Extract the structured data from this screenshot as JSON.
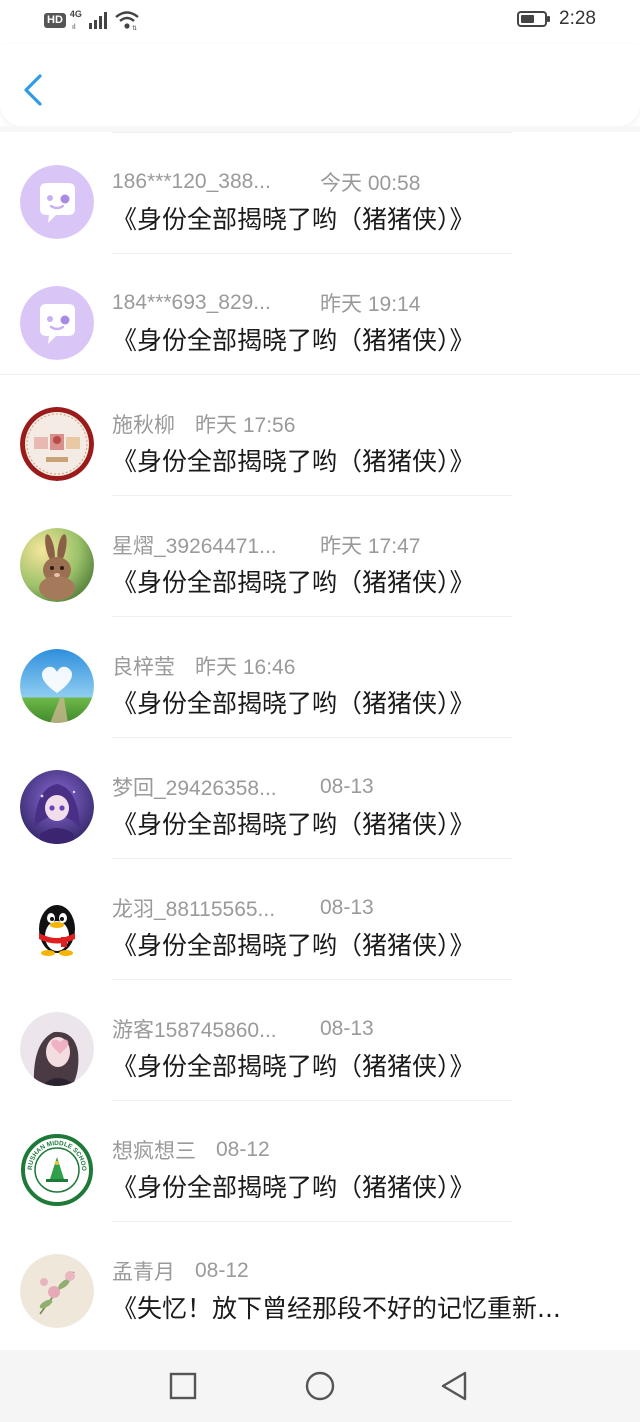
{
  "status_bar": {
    "hd": "HD",
    "network": "4G",
    "time": "2:28"
  },
  "colors": {
    "accent": "#2f9bea",
    "meta_text": "#9a9a9a",
    "title_text": "#1a1a1a",
    "default_avatar_bg": "#d9c6f7"
  },
  "messages": [
    {
      "name": "186***120_388...",
      "time": "今天 00:58",
      "title": "《身份全部揭晓了哟（猪猪侠）》",
      "avatar": "chat-bubble-avatar"
    },
    {
      "name": "184***693_829...",
      "time": "昨天 19:14",
      "title": "《身份全部揭晓了哟（猪猪侠）》",
      "avatar": "chat-bubble-avatar"
    },
    {
      "name": "施秋柳",
      "time": "昨天 17:56",
      "title": "《身份全部揭晓了哟（猪猪侠）》",
      "avatar": "embroidery-avatar"
    },
    {
      "name": "星熠_39264471...",
      "time": "昨天 17:47",
      "title": "《身份全部揭晓了哟（猪猪侠）》",
      "avatar": "rabbit-avatar"
    },
    {
      "name": "良梓莹",
      "time": "昨天 16:46",
      "title": "《身份全部揭晓了哟（猪猪侠）》",
      "avatar": "heart-sky-avatar"
    },
    {
      "name": "梦回_29426358...",
      "time": "08-13",
      "title": "《身份全部揭晓了哟（猪猪侠）》",
      "avatar": "anime-girl-avatar"
    },
    {
      "name": "龙羽_88115565...",
      "time": "08-13",
      "title": "《身份全部揭晓了哟（猪猪侠）》",
      "avatar": "penguin-avatar"
    },
    {
      "name": "游客158745860...",
      "time": "08-13",
      "title": "《身份全部揭晓了哟（猪猪侠）》",
      "avatar": "girl-photo-avatar"
    },
    {
      "name": "想疯想三",
      "time": "08-12",
      "title": "《身份全部揭晓了哟（猪猪侠）》",
      "avatar": "school-logo-avatar"
    },
    {
      "name": "孟青月",
      "time": "08-12",
      "title": "《失忆！放下曾经那段不好的记忆重新...",
      "avatar": "flower-painting-avatar"
    }
  ],
  "school_logo_text": "RUSHAN MIDDLE SCHOOL"
}
